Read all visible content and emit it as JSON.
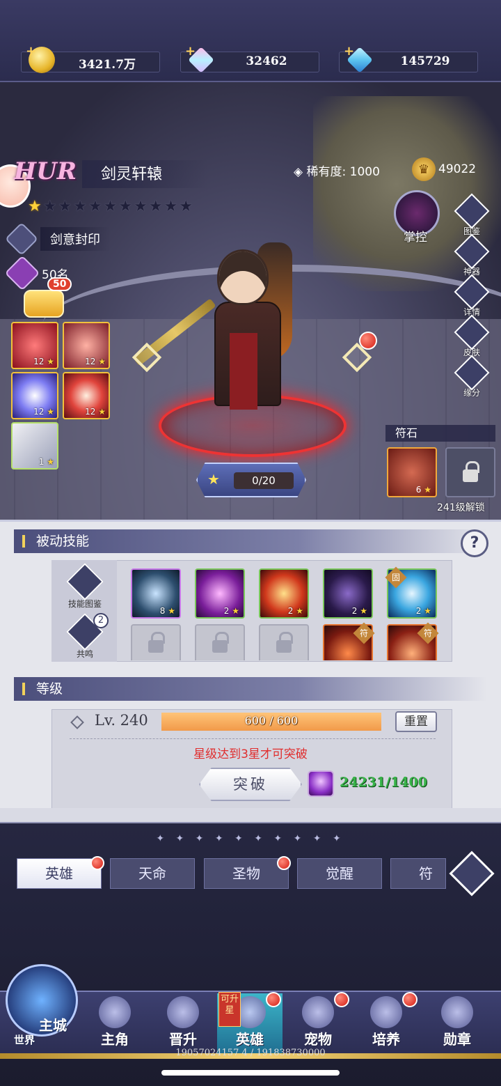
{
  "currencies": [
    {
      "icon": "gold-coin-icon",
      "value": "3421.7万"
    },
    {
      "icon": "rainbow-diamond-icon",
      "value": "32462"
    },
    {
      "icon": "blue-diamond-icon",
      "value": "145729"
    }
  ],
  "hero": {
    "rank": "HUR",
    "name": "剑灵轩辕",
    "rarity_label": "稀有度:",
    "rarity_value": "1000",
    "power": "49022",
    "stars_total": 11,
    "stars_lit": 1,
    "tag": "剑意封印",
    "count": "50名",
    "chat_badge": "50",
    "control_label": "掌控",
    "upgrade_progress": "0/20"
  },
  "active_skills": [
    {
      "level": "12"
    },
    {
      "level": "12"
    },
    {
      "level": "12"
    },
    {
      "level": "12"
    },
    {
      "level": "1"
    }
  ],
  "side_menu": [
    "图鉴",
    "神器",
    "详情",
    "皮肤",
    "缘分"
  ],
  "rune": {
    "title": "符石",
    "slot_level": "6",
    "unlock_text": "241级解锁"
  },
  "passive": {
    "title": "被动技能",
    "help": "?",
    "book_label": "技能图鉴",
    "resonance_label": "共鸣",
    "resonance_badge": "2",
    "skills": [
      {
        "level": "8"
      },
      {
        "level": "2"
      },
      {
        "level": "2"
      },
      {
        "level": "2"
      },
      {
        "level": "2",
        "tag": "固"
      }
    ],
    "row2_tags": [
      "符",
      "符"
    ]
  },
  "level": {
    "title": "等级",
    "lv_text": "Lv. 240",
    "exp_text": "600 / 600",
    "exp_fraction": 1.0,
    "reset_label": "重置",
    "warning": "星级达到3星才可突破",
    "break_label": "突破",
    "material_value": "24231/1400"
  },
  "tabs": [
    {
      "label": "英雄",
      "active": true,
      "dot": true
    },
    {
      "label": "天命",
      "active": false,
      "dot": false
    },
    {
      "label": "圣物",
      "active": false,
      "dot": true
    },
    {
      "label": "觉醒",
      "active": false,
      "dot": false
    },
    {
      "label": "符文",
      "active": false,
      "dot": false
    }
  ],
  "tab_dots": "✦ ✦ ✦ ✦ ✦ ✦ ✦ ✦ ✦ ✦",
  "nav": {
    "world_main": "主城",
    "world_sub": "世界",
    "new_flag": "可升星",
    "items": [
      {
        "label": "主角"
      },
      {
        "label": "晋升"
      },
      {
        "label": "英雄"
      },
      {
        "label": "宠物"
      },
      {
        "label": "培养"
      },
      {
        "label": "勋章"
      }
    ]
  },
  "footer_id": "19057024157 4 / 191838730000",
  "colors": {
    "accent_red": "#d41c12",
    "gold": "#ffd23a",
    "exp_fill": "#f19a4a",
    "material_green": "#39b44a"
  }
}
